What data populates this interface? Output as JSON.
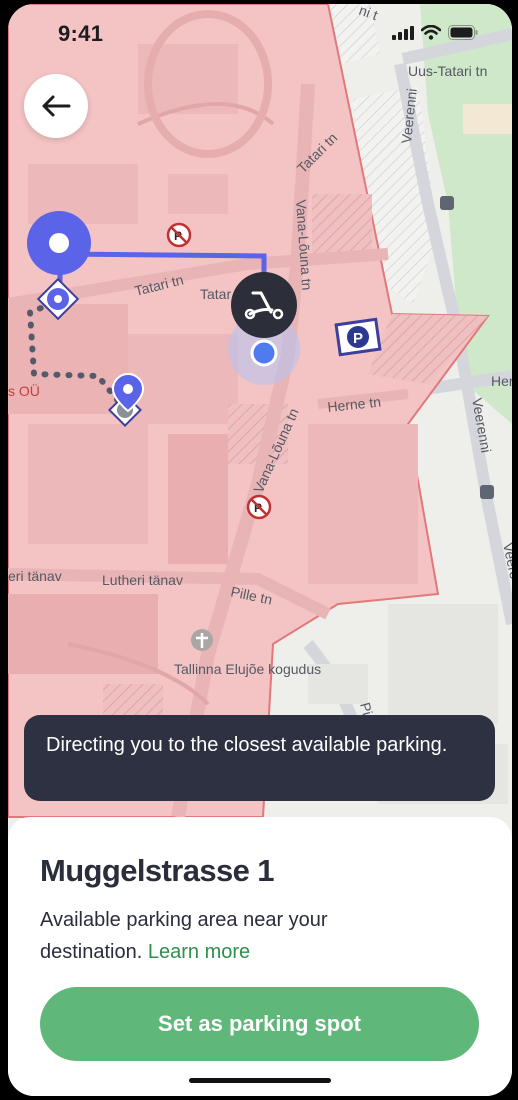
{
  "status_bar": {
    "time": "9:41"
  },
  "map": {
    "streets": {
      "uus_tatari": "Uus-Tatari tn",
      "veerenni_1": "Veerenni",
      "veerenni_2": "Veerenni",
      "veerenni_3": "Veere",
      "tatari_1": "Tatari tn",
      "tatari_2": "Tatari tn",
      "tatari_3": "Tatar",
      "vana_louna_1": "Vana-Lõuna tn",
      "vana_louna_2": "Vana-Lõuna tn",
      "herne_1": "Herne tn",
      "herne_2": "Her",
      "lutheri_1": "eri tänav",
      "lutheri_2": "Lutheri tänav",
      "pille": "Pille tn",
      "pi": "Pi",
      "tn_top": "tn",
      "ini_top": "ni t"
    },
    "pois": {
      "church": "Tallinna Elujõe kogudus",
      "business": "s OÜ"
    }
  },
  "toast": {
    "text": "Directing you to the closest available parking."
  },
  "sheet": {
    "title": "Muggelstrasse 1",
    "description": "Available parking area near your destination.",
    "learn_more": "Learn more",
    "cta_label": "Set as parking spot"
  },
  "colors": {
    "zone_fill": "#f1c5c6",
    "zone_border": "#e2787c",
    "route": "#5b63e8",
    "accent_green": "#5fb87a",
    "toast_bg": "#2e3141"
  }
}
